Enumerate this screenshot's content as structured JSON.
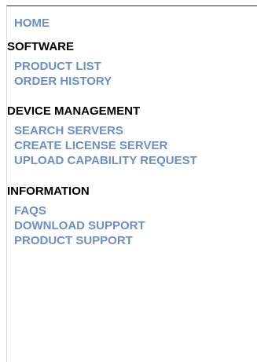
{
  "nav": {
    "home": "HOME",
    "sections": [
      {
        "heading": "SOFTWARE",
        "items": [
          "PRODUCT LIST",
          "ORDER HISTORY"
        ]
      },
      {
        "heading": "DEVICE MANAGEMENT",
        "items": [
          "SEARCH SERVERS",
          "CREATE LICENSE SERVER",
          "UPLOAD CAPABILITY REQUEST"
        ]
      },
      {
        "heading": "INFORMATION",
        "items": [
          "FAQS",
          "DOWNLOAD SUPPORT",
          "PRODUCT SUPPORT"
        ]
      }
    ]
  },
  "colors": {
    "link": "#6b90c8",
    "heading": "#000000",
    "top_border": "#222222",
    "left_border": "#dcdcdc"
  }
}
